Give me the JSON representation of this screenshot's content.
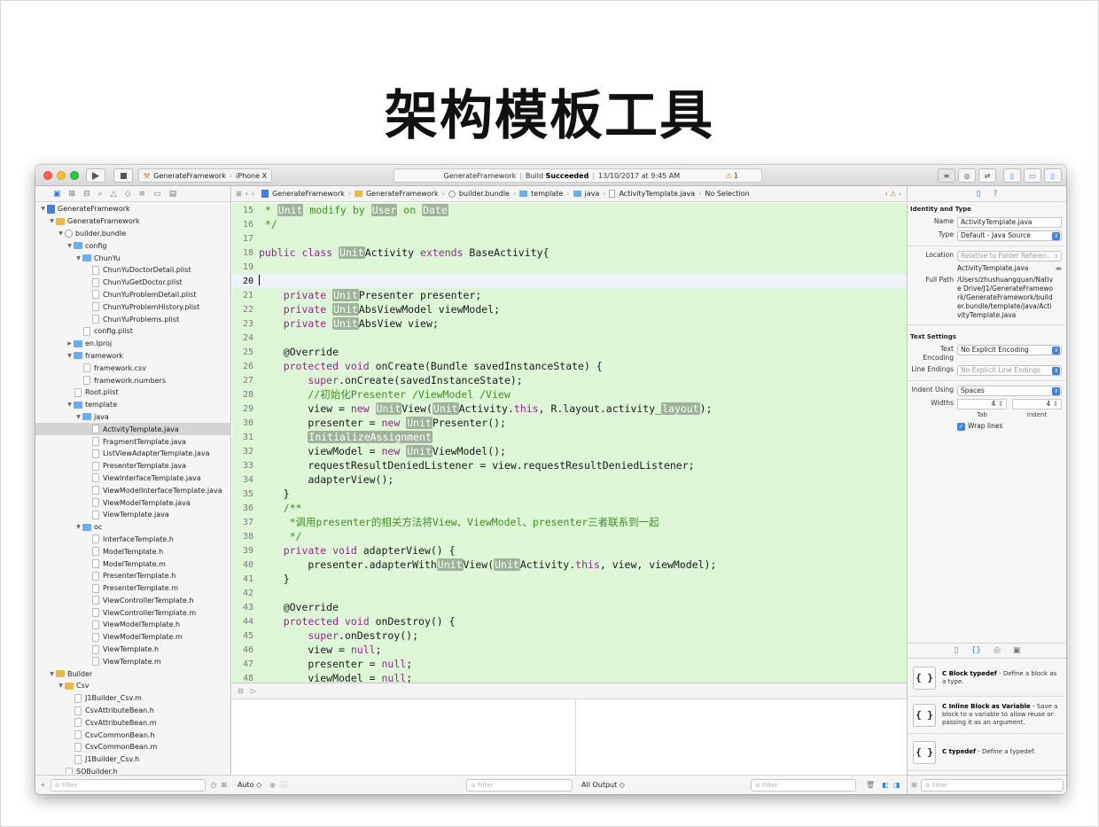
{
  "slide": {
    "title": "架构模板工具"
  },
  "toolbar": {
    "scheme": "GenerateFramework",
    "device": "iPhone X",
    "activity_project": "GenerateFramework",
    "activity_build": "Build",
    "activity_status": "Succeeded",
    "activity_time": "13/10/2017 at 9:45 AM",
    "warning_count": "1"
  },
  "navigator": {
    "filter_placeholder": "Filter",
    "tree": [
      {
        "label": "GenerateFramework",
        "indent": 0,
        "icon": "project",
        "disc": "open"
      },
      {
        "label": "GenerateFramework",
        "indent": 1,
        "icon": "yfolder",
        "disc": "open"
      },
      {
        "label": "builder.bundle",
        "indent": 2,
        "icon": "bundle",
        "disc": "open"
      },
      {
        "label": "config",
        "indent": 3,
        "icon": "folder",
        "disc": "open"
      },
      {
        "label": "ChunYu",
        "indent": 4,
        "icon": "folder",
        "disc": "open"
      },
      {
        "label": "ChunYuDoctorDetail.plist",
        "indent": 5,
        "icon": "file",
        "disc": ""
      },
      {
        "label": "ChunYuGetDoctor.plist",
        "indent": 5,
        "icon": "file",
        "disc": ""
      },
      {
        "label": "ChunYuProblemDetail.plist",
        "indent": 5,
        "icon": "file",
        "disc": ""
      },
      {
        "label": "ChunYuProblemHistory.plist",
        "indent": 5,
        "icon": "file",
        "disc": ""
      },
      {
        "label": "ChunYuProblems.plist",
        "indent": 5,
        "icon": "file",
        "disc": ""
      },
      {
        "label": "config.plist",
        "indent": 4,
        "icon": "file",
        "disc": ""
      },
      {
        "label": "en.lproj",
        "indent": 3,
        "icon": "folder",
        "disc": "closed"
      },
      {
        "label": "framework",
        "indent": 3,
        "icon": "folder",
        "disc": "open"
      },
      {
        "label": "framework.csv",
        "indent": 4,
        "icon": "file",
        "disc": ""
      },
      {
        "label": "framework.numbers",
        "indent": 4,
        "icon": "file",
        "disc": ""
      },
      {
        "label": "Root.plist",
        "indent": 3,
        "icon": "file",
        "disc": ""
      },
      {
        "label": "template",
        "indent": 3,
        "icon": "folder",
        "disc": "open"
      },
      {
        "label": "java",
        "indent": 4,
        "icon": "folder",
        "disc": "open"
      },
      {
        "label": "ActivityTemplate.java",
        "indent": 5,
        "icon": "file",
        "disc": "",
        "selected": true
      },
      {
        "label": "FragmentTemplate.java",
        "indent": 5,
        "icon": "file",
        "disc": ""
      },
      {
        "label": "ListViewAdapterTemplate.java",
        "indent": 5,
        "icon": "file",
        "disc": ""
      },
      {
        "label": "PresenterTemplate.java",
        "indent": 5,
        "icon": "file",
        "disc": ""
      },
      {
        "label": "ViewInterfaceTemplate.java",
        "indent": 5,
        "icon": "file",
        "disc": ""
      },
      {
        "label": "ViewModelInterfaceTemplate.java",
        "indent": 5,
        "icon": "file",
        "disc": ""
      },
      {
        "label": "ViewModelTemplate.java",
        "indent": 5,
        "icon": "file",
        "disc": ""
      },
      {
        "label": "ViewTemplate.java",
        "indent": 5,
        "icon": "file",
        "disc": ""
      },
      {
        "label": "oc",
        "indent": 4,
        "icon": "folder",
        "disc": "open"
      },
      {
        "label": "InterfaceTemplate.h",
        "indent": 5,
        "icon": "hfile",
        "disc": ""
      },
      {
        "label": "ModelTemplate.h",
        "indent": 5,
        "icon": "hfile",
        "disc": ""
      },
      {
        "label": "ModelTemplate.m",
        "indent": 5,
        "icon": "hfile",
        "disc": ""
      },
      {
        "label": "PresenterTemplate.h",
        "indent": 5,
        "icon": "hfile",
        "disc": ""
      },
      {
        "label": "PresenterTemplate.m",
        "indent": 5,
        "icon": "hfile",
        "disc": ""
      },
      {
        "label": "ViewControllerTemplate.h",
        "indent": 5,
        "icon": "hfile",
        "disc": ""
      },
      {
        "label": "ViewControllerTemplate.m",
        "indent": 5,
        "icon": "hfile",
        "disc": ""
      },
      {
        "label": "ViewModelTemplate.h",
        "indent": 5,
        "icon": "hfile",
        "disc": ""
      },
      {
        "label": "ViewModelTemplate.m",
        "indent": 5,
        "icon": "hfile",
        "disc": ""
      },
      {
        "label": "ViewTemplate.h",
        "indent": 5,
        "icon": "hfile",
        "disc": ""
      },
      {
        "label": "ViewTemplate.m",
        "indent": 5,
        "icon": "hfile",
        "disc": ""
      },
      {
        "label": "Builder",
        "indent": 1,
        "icon": "yfolder",
        "disc": "open"
      },
      {
        "label": "Csv",
        "indent": 2,
        "icon": "yfolder",
        "disc": "open"
      },
      {
        "label": "J1Builder_Csv.m",
        "indent": 3,
        "icon": "hfile",
        "disc": ""
      },
      {
        "label": "CsvAttributeBean.h",
        "indent": 3,
        "icon": "hfile",
        "disc": ""
      },
      {
        "label": "CsvAttributeBean.m",
        "indent": 3,
        "icon": "hfile",
        "disc": ""
      },
      {
        "label": "CsvCommonBean.h",
        "indent": 3,
        "icon": "hfile",
        "disc": ""
      },
      {
        "label": "CsvCommonBean.m",
        "indent": 3,
        "icon": "hfile",
        "disc": ""
      },
      {
        "label": "J1Builder_Csv.h",
        "indent": 3,
        "icon": "hfile",
        "disc": ""
      },
      {
        "label": "SQBuilder.h",
        "indent": 2,
        "icon": "hfile",
        "disc": ""
      }
    ]
  },
  "jumpbar": {
    "items": [
      "GenerateFramework",
      "GenerateFramework",
      "builder.bundle",
      "template",
      "java",
      "ActivityTemplate.java",
      "No Selection"
    ]
  },
  "code": {
    "lines": [
      {
        "n": "15",
        "segs": [
          [
            " * ",
            "cm"
          ],
          [
            "Unit",
            "ph"
          ],
          [
            " modify by ",
            "cm"
          ],
          [
            "User",
            "ph"
          ],
          [
            " on ",
            "cm"
          ],
          [
            "Date",
            "ph"
          ]
        ]
      },
      {
        "n": "16",
        "segs": [
          [
            " */",
            "cm"
          ]
        ]
      },
      {
        "n": "17",
        "segs": []
      },
      {
        "n": "18",
        "segs": [
          [
            "public class ",
            "kw"
          ],
          [
            "Unit",
            "ph"
          ],
          [
            "Activity ",
            ""
          ],
          [
            "extends",
            "kw"
          ],
          [
            " BaseActivity{",
            ""
          ]
        ]
      },
      {
        "n": "19",
        "segs": []
      },
      {
        "n": "20",
        "segs": [
          [
            "|cursor|",
            "cursor"
          ]
        ],
        "current": true
      },
      {
        "n": "21",
        "segs": [
          [
            "    private ",
            "kw"
          ],
          [
            "Unit",
            "ph"
          ],
          [
            "Presenter presenter;",
            ""
          ]
        ]
      },
      {
        "n": "22",
        "segs": [
          [
            "    private ",
            "kw"
          ],
          [
            "Unit",
            "ph"
          ],
          [
            "AbsViewModel viewModel;",
            ""
          ]
        ]
      },
      {
        "n": "23",
        "segs": [
          [
            "    private ",
            "kw"
          ],
          [
            "Unit",
            "ph"
          ],
          [
            "AbsView view;",
            ""
          ]
        ]
      },
      {
        "n": "24",
        "segs": []
      },
      {
        "n": "25",
        "segs": [
          [
            "    @Override",
            ""
          ]
        ]
      },
      {
        "n": "26",
        "segs": [
          [
            "    protected void ",
            "kw"
          ],
          [
            "onCreate(Bundle savedInstanceState) {",
            ""
          ]
        ]
      },
      {
        "n": "27",
        "segs": [
          [
            "        super",
            "kw"
          ],
          [
            ".onCreate(savedInstanceState);",
            ""
          ]
        ]
      },
      {
        "n": "28",
        "segs": [
          [
            "        //初始化Presenter /ViewModel /View",
            "cm"
          ]
        ]
      },
      {
        "n": "29",
        "segs": [
          [
            "        view = ",
            ""
          ],
          [
            "new ",
            "kw"
          ],
          [
            "Unit",
            "ph"
          ],
          [
            "View(",
            ""
          ],
          [
            "Unit",
            "ph"
          ],
          [
            "Activity.",
            ""
          ],
          [
            "this",
            "kw"
          ],
          [
            ", R.layout.activity_",
            ""
          ],
          [
            "layout",
            "ph"
          ],
          [
            ");",
            ""
          ]
        ]
      },
      {
        "n": "30",
        "segs": [
          [
            "        presenter = ",
            ""
          ],
          [
            "new ",
            "kw"
          ],
          [
            "Unit",
            "ph"
          ],
          [
            "Presenter();",
            ""
          ]
        ]
      },
      {
        "n": "31",
        "segs": [
          [
            "        ",
            ""
          ],
          [
            "InitializeAssignment",
            "phc"
          ]
        ]
      },
      {
        "n": "32",
        "segs": [
          [
            "        viewModel = ",
            ""
          ],
          [
            "new ",
            "kw"
          ],
          [
            "Unit",
            "ph"
          ],
          [
            "ViewModel();",
            ""
          ]
        ]
      },
      {
        "n": "33",
        "segs": [
          [
            "        requestResultDeniedListener = view.requestResultDeniedListener;",
            ""
          ]
        ]
      },
      {
        "n": "34",
        "segs": [
          [
            "        adapterView();",
            ""
          ]
        ]
      },
      {
        "n": "35",
        "segs": [
          [
            "    }",
            ""
          ]
        ]
      },
      {
        "n": "36",
        "segs": [
          [
            "    /**",
            "cm"
          ]
        ]
      },
      {
        "n": "37",
        "segs": [
          [
            "     *调用presenter的相关方法将View、ViewModel、presenter三者联系到一起",
            "cm"
          ]
        ]
      },
      {
        "n": "38",
        "segs": [
          [
            "     */",
            "cm"
          ]
        ]
      },
      {
        "n": "39",
        "segs": [
          [
            "    private void ",
            "kw"
          ],
          [
            "adapterView() {",
            ""
          ]
        ]
      },
      {
        "n": "40",
        "segs": [
          [
            "        presenter.adapterWith",
            ""
          ],
          [
            "Unit",
            "ph"
          ],
          [
            "View(",
            ""
          ],
          [
            "Unit",
            "ph"
          ],
          [
            "Activity.",
            ""
          ],
          [
            "this",
            "kw"
          ],
          [
            ", view, viewModel);",
            ""
          ]
        ]
      },
      {
        "n": "41",
        "segs": [
          [
            "    }",
            ""
          ]
        ]
      },
      {
        "n": "42",
        "segs": []
      },
      {
        "n": "43",
        "segs": [
          [
            "    @Override",
            ""
          ]
        ]
      },
      {
        "n": "44",
        "segs": [
          [
            "    protected void ",
            "kw"
          ],
          [
            "onDestroy() {",
            ""
          ]
        ]
      },
      {
        "n": "45",
        "segs": [
          [
            "        super",
            "kw"
          ],
          [
            ".onDestroy();",
            ""
          ]
        ]
      },
      {
        "n": "46",
        "segs": [
          [
            "        view = ",
            ""
          ],
          [
            "null",
            "kw"
          ],
          [
            ";",
            ""
          ]
        ]
      },
      {
        "n": "47",
        "segs": [
          [
            "        presenter = ",
            ""
          ],
          [
            "null",
            "kw"
          ],
          [
            ";",
            ""
          ]
        ]
      },
      {
        "n": "48",
        "segs": [
          [
            "        viewModel = ",
            ""
          ],
          [
            "null",
            "kw"
          ],
          [
            ";",
            ""
          ]
        ]
      }
    ]
  },
  "debug": {
    "auto_label": "Auto ◇",
    "filter_placeholder": "Filter",
    "output_label": "All Output ◇"
  },
  "inspector": {
    "identity_title": "Identity and Type",
    "name_label": "Name",
    "name_value": "ActivityTemplate.java",
    "type_label": "Type",
    "type_value": "Default - Java Source",
    "location_label": "Location",
    "location_value": "Relative to Folder Referen...",
    "location_file": "ActivityTemplate.java",
    "fullpath_label": "Full Path",
    "fullpath_value": "/Users/zhushuangquan/Native Drive/J1/GenerateFramework/GenerateFramework/builder.bundle/template/java/ActivityTemplate.java",
    "text_settings_title": "Text Settings",
    "encoding_label": "Text Encoding",
    "encoding_value": "No Explicit Encoding",
    "endings_label": "Line Endings",
    "endings_value": "No Explicit Line Endings",
    "indent_label": "Indent Using",
    "indent_value": "Spaces",
    "widths_label": "Widths",
    "tab_value": "4",
    "indent_width_value": "4",
    "tab_label": "Tab",
    "indent_width_label": "Indent",
    "wrap_label": "Wrap lines",
    "library": [
      {
        "name": "C Block typedef",
        "desc": " - Define a block as a type."
      },
      {
        "name": "C Inline Block as Variable",
        "desc": " - Save a block to a variable to allow reuse or passing it as an argument."
      },
      {
        "name": "C typedef",
        "desc": " - Define a typedef."
      }
    ],
    "library_icon": "{ }",
    "filter_placeholder": "Filter"
  }
}
